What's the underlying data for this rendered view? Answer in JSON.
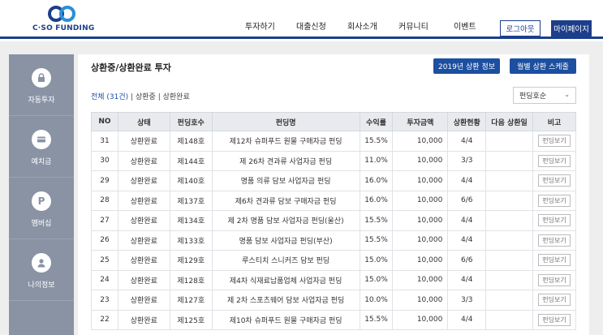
{
  "brand": {
    "name": "C·SO FUNDING",
    "accent": "#1c3f8c"
  },
  "nav": [
    "투자하기",
    "대출신청",
    "회사소개",
    "커뮤니티",
    "이벤트"
  ],
  "header_buttons": {
    "logout": "로그아웃",
    "mypage": "마이페이지"
  },
  "sidebar": [
    {
      "label": "자동투자",
      "icon": "lock-icon"
    },
    {
      "label": "예치금",
      "icon": "wallet-icon"
    },
    {
      "label": "멤버십",
      "icon": "p-badge-icon"
    },
    {
      "label": "나의정보",
      "icon": "user-icon"
    }
  ],
  "page": {
    "title": "상환중/상환완료 투자",
    "btn_2019": "2019년 상환 정보",
    "btn_monthly": "월별 상환 스케줄",
    "filter_all": "전체 (31건)",
    "filter_sep1": "|",
    "filter_repaying": "상환중",
    "filter_sep2": "|",
    "filter_done": "상환완료",
    "sort_select": "펀딩호순"
  },
  "table": {
    "headers": [
      "NO",
      "상태",
      "펀딩호수",
      "펀딩명",
      "수익률",
      "투자금액",
      "상환현황",
      "다음 상환일",
      "비고"
    ],
    "view_btn": "펀딩보기",
    "rows": [
      {
        "no": "31",
        "status": "상환완료",
        "fund_no": "제148호",
        "name": "제12차 슈퍼푸드 원물 구매자금 펀딩",
        "rate": "15.5%",
        "amount": "10,000",
        "progress": "4/4",
        "next": ""
      },
      {
        "no": "30",
        "status": "상환완료",
        "fund_no": "제144호",
        "name": "제 26차 견과류 사업자금 펀딩",
        "rate": "11.0%",
        "amount": "10,000",
        "progress": "3/3",
        "next": ""
      },
      {
        "no": "29",
        "status": "상환완료",
        "fund_no": "제140호",
        "name": "명품 의류 담보 사업자금 펀딩",
        "rate": "16.0%",
        "amount": "10,000",
        "progress": "4/4",
        "next": ""
      },
      {
        "no": "28",
        "status": "상환완료",
        "fund_no": "제137호",
        "name": "제6차 견과류 담보 구매자금 펀딩",
        "rate": "16.0%",
        "amount": "10,000",
        "progress": "6/6",
        "next": ""
      },
      {
        "no": "27",
        "status": "상환완료",
        "fund_no": "제134호",
        "name": "제 2차 명품 담보 사업자금 펀딩(울산)",
        "rate": "15.5%",
        "amount": "10,000",
        "progress": "4/4",
        "next": ""
      },
      {
        "no": "26",
        "status": "상환완료",
        "fund_no": "제133호",
        "name": "명품 담보 사업자금 펀딩(부산)",
        "rate": "15.5%",
        "amount": "10,000",
        "progress": "4/4",
        "next": ""
      },
      {
        "no": "25",
        "status": "상환완료",
        "fund_no": "제129호",
        "name": "루스티치 스니커즈 담보 펀딩",
        "rate": "15.0%",
        "amount": "10,000",
        "progress": "6/6",
        "next": ""
      },
      {
        "no": "24",
        "status": "상환완료",
        "fund_no": "제128호",
        "name": "제4차 식재료납품업체 사업자금 펀딩",
        "rate": "15.0%",
        "amount": "10,000",
        "progress": "4/4",
        "next": ""
      },
      {
        "no": "23",
        "status": "상환완료",
        "fund_no": "제127호",
        "name": "제 2차 스포츠웨어 담보 사업자금 펀딩",
        "rate": "10.0%",
        "amount": "10,000",
        "progress": "3/3",
        "next": ""
      },
      {
        "no": "22",
        "status": "상환완료",
        "fund_no": "제125호",
        "name": "제10차 슈퍼푸드 원물 구매자금 펀딩",
        "rate": "15.5%",
        "amount": "10,000",
        "progress": "4/4",
        "next": ""
      }
    ]
  }
}
